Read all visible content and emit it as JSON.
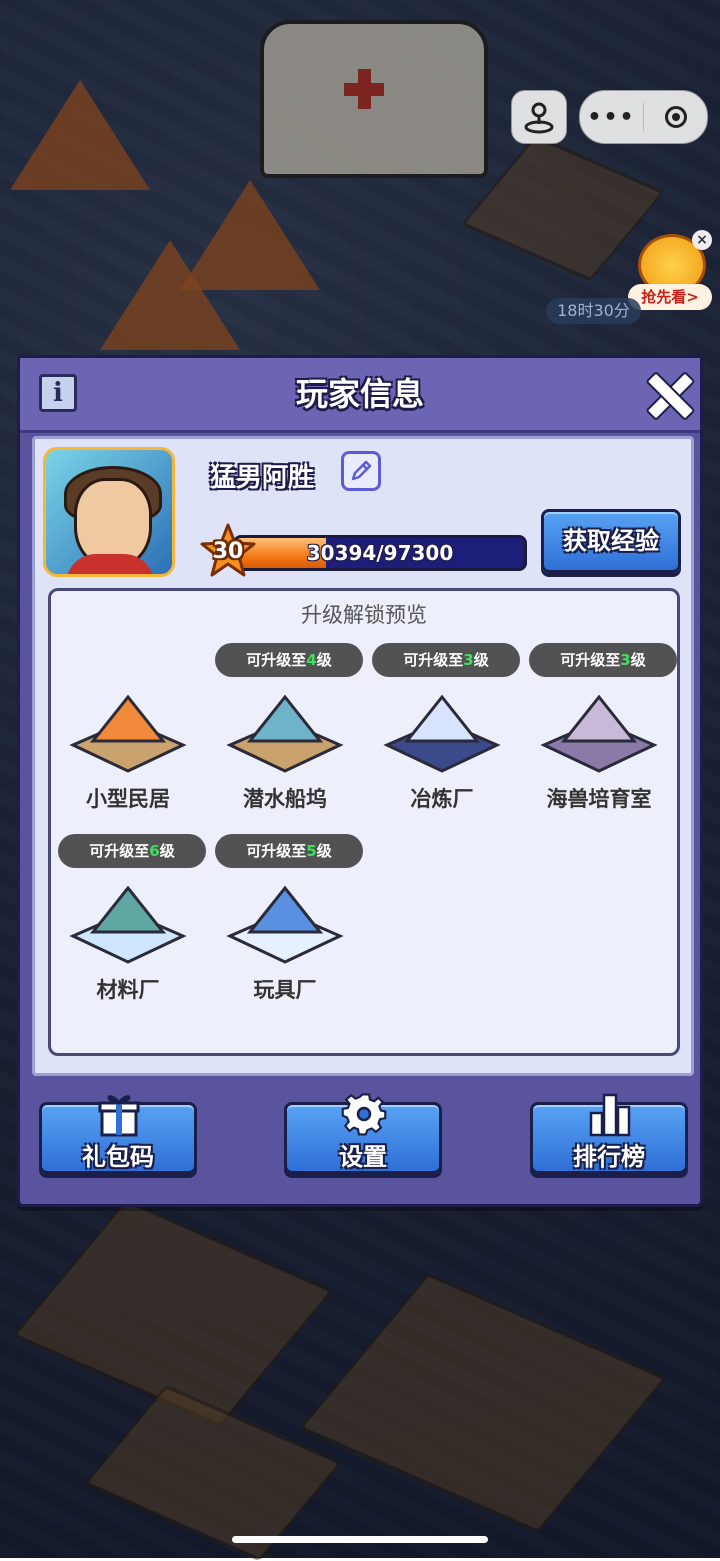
{
  "top_controls": {
    "joystick_icon": "joystick-icon",
    "menu_dots": "•••",
    "target_icon": "record-icon"
  },
  "promo": {
    "label": "抢先看>",
    "close": "×",
    "timer": "18时30分"
  },
  "panel": {
    "title": "玩家信息",
    "info_icon": "i",
    "player": {
      "name": "猛男阿胜",
      "level": "30",
      "xp_text": "30394/97300",
      "xp_current": 30394,
      "xp_max": 97300
    },
    "get_exp_button": "获取经验",
    "preview": {
      "title": "升级解锁预览",
      "items": [
        {
          "label": "小型民居",
          "badge_prefix": "",
          "badge_num": "",
          "badge_suffix": ""
        },
        {
          "label": "潜水船坞",
          "badge_prefix": "可升级至",
          "badge_num": "4",
          "badge_suffix": "级"
        },
        {
          "label": "冶炼厂",
          "badge_prefix": "可升级至",
          "badge_num": "3",
          "badge_suffix": "级"
        },
        {
          "label": "海兽培育室",
          "badge_prefix": "可升级至",
          "badge_num": "3",
          "badge_suffix": "级"
        },
        {
          "label": "材料厂",
          "badge_prefix": "可升级至",
          "badge_num": "6",
          "badge_suffix": "级"
        },
        {
          "label": "玩具厂",
          "badge_prefix": "可升级至",
          "badge_num": "5",
          "badge_suffix": "级"
        }
      ]
    },
    "footer": {
      "gift_code": "礼包码",
      "settings": "设置",
      "leaderboard": "排行榜"
    }
  },
  "colors": {
    "panel": "#5a549e",
    "accent_button": "#2f6fd6",
    "xp_fill": "#f47a16",
    "badge_level": "#3ee05a"
  }
}
